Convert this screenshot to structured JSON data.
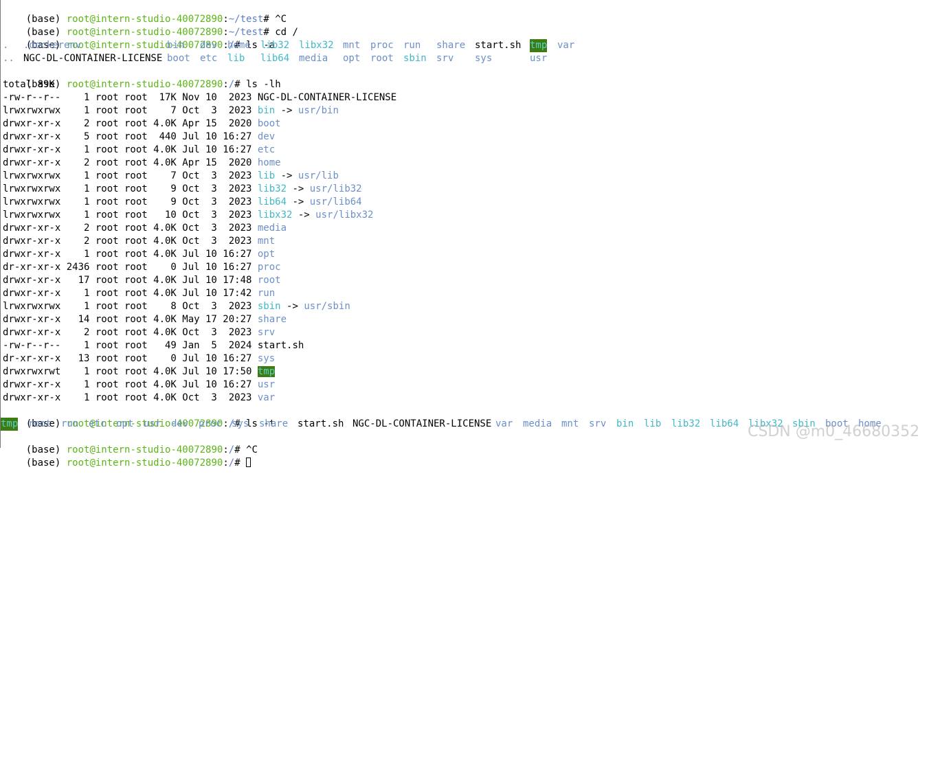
{
  "colors": {
    "background": "#ffffff",
    "text": "#000000",
    "user_host": "#5cb516",
    "directory": "#6b8fc9",
    "symlink": "#3fb8c8",
    "sticky_dir_bg": "#3c7c12"
  },
  "prompt": {
    "env": "(base)",
    "user_host": "root@intern-studio-40072890",
    "colon": ":",
    "home_path": "~/test",
    "root_path": "/",
    "suffix": "#"
  },
  "commands": {
    "ctrl_c": "^C",
    "cd_root": "cd /",
    "ls_a": "ls -a",
    "ls_lh": "ls -lh",
    "ls_t": "ls -t"
  },
  "ls_a_output": {
    "row1": [
      ".",
      ".dockerenv",
      "bin",
      "dev",
      "home",
      "lib32",
      "libx32",
      "mnt",
      "proc",
      "run",
      "share",
      "start.sh",
      "tmp",
      "var"
    ],
    "row2": [
      "..",
      "NGC-DL-CONTAINER-LICENSE",
      "boot",
      "etc",
      "lib",
      "lib64",
      "media",
      "opt",
      "root",
      "sbin",
      "srv",
      "sys",
      "usr"
    ]
  },
  "ls_lh_output": {
    "total": "total 89K",
    "entries": [
      {
        "prefix": "-rw-r--r--    1 root root  17K Nov 10  2023 ",
        "name": "NGC-DL-CONTAINER-LICENSE",
        "arrow": "",
        "target": ""
      },
      {
        "prefix": "lrwxrwxrwx    1 root root    7 Oct  3  2023 ",
        "name": "bin",
        "arrow": " -> ",
        "target": "usr/bin"
      },
      {
        "prefix": "drwxr-xr-x    2 root root 4.0K Apr 15  2020 ",
        "name": "boot",
        "arrow": "",
        "target": ""
      },
      {
        "prefix": "drwxr-xr-x    5 root root  440 Jul 10 16:27 ",
        "name": "dev",
        "arrow": "",
        "target": ""
      },
      {
        "prefix": "drwxr-xr-x    1 root root 4.0K Jul 10 16:27 ",
        "name": "etc",
        "arrow": "",
        "target": ""
      },
      {
        "prefix": "drwxr-xr-x    2 root root 4.0K Apr 15  2020 ",
        "name": "home",
        "arrow": "",
        "target": ""
      },
      {
        "prefix": "lrwxrwxrwx    1 root root    7 Oct  3  2023 ",
        "name": "lib",
        "arrow": " -> ",
        "target": "usr/lib"
      },
      {
        "prefix": "lrwxrwxrwx    1 root root    9 Oct  3  2023 ",
        "name": "lib32",
        "arrow": " -> ",
        "target": "usr/lib32"
      },
      {
        "prefix": "lrwxrwxrwx    1 root root    9 Oct  3  2023 ",
        "name": "lib64",
        "arrow": " -> ",
        "target": "usr/lib64"
      },
      {
        "prefix": "lrwxrwxrwx    1 root root   10 Oct  3  2023 ",
        "name": "libx32",
        "arrow": " -> ",
        "target": "usr/libx32"
      },
      {
        "prefix": "drwxr-xr-x    2 root root 4.0K Oct  3  2023 ",
        "name": "media",
        "arrow": "",
        "target": ""
      },
      {
        "prefix": "drwxr-xr-x    2 root root 4.0K Oct  3  2023 ",
        "name": "mnt",
        "arrow": "",
        "target": ""
      },
      {
        "prefix": "drwxr-xr-x    1 root root 4.0K Jul 10 16:27 ",
        "name": "opt",
        "arrow": "",
        "target": ""
      },
      {
        "prefix": "dr-xr-xr-x 2436 root root    0 Jul 10 16:27 ",
        "name": "proc",
        "arrow": "",
        "target": ""
      },
      {
        "prefix": "drwxr-xr-x   17 root root 4.0K Jul 10 17:48 ",
        "name": "root",
        "arrow": "",
        "target": ""
      },
      {
        "prefix": "drwxr-xr-x    1 root root 4.0K Jul 10 17:42 ",
        "name": "run",
        "arrow": "",
        "target": ""
      },
      {
        "prefix": "lrwxrwxrwx    1 root root    8 Oct  3  2023 ",
        "name": "sbin",
        "arrow": " -> ",
        "target": "usr/sbin"
      },
      {
        "prefix": "drwxr-xr-x   14 root root 4.0K May 17 20:27 ",
        "name": "share",
        "arrow": "",
        "target": ""
      },
      {
        "prefix": "drwxr-xr-x    2 root root 4.0K Oct  3  2023 ",
        "name": "srv",
        "arrow": "",
        "target": ""
      },
      {
        "prefix": "-rw-r--r--    1 root root   49 Jan  5  2024 ",
        "name": "start.sh",
        "arrow": "",
        "target": ""
      },
      {
        "prefix": "dr-xr-xr-x   13 root root    0 Jul 10 16:27 ",
        "name": "sys",
        "arrow": "",
        "target": ""
      },
      {
        "prefix": "drwxrwxrwt    1 root root 4.0K Jul 10 17:50 ",
        "name": "tmp",
        "arrow": "",
        "target": ""
      },
      {
        "prefix": "drwxr-xr-x    1 root root 4.0K Jul 10 16:27 ",
        "name": "usr",
        "arrow": "",
        "target": ""
      },
      {
        "prefix": "drwxr-xr-x    1 root root 4.0K Oct  3  2023 ",
        "name": "var",
        "arrow": "",
        "target": ""
      }
    ]
  },
  "ls_t_output": [
    "tmp",
    "root",
    "run",
    "etc",
    "opt",
    "usr",
    "dev",
    "proc",
    "sys",
    "share",
    "start.sh",
    "NGC-DL-CONTAINER-LICENSE",
    "var",
    "media",
    "mnt",
    "srv",
    "bin",
    "lib",
    "lib32",
    "lib64",
    "libx32",
    "sbin",
    "boot",
    "home"
  ],
  "watermark": "CSDN @m0_46680352"
}
